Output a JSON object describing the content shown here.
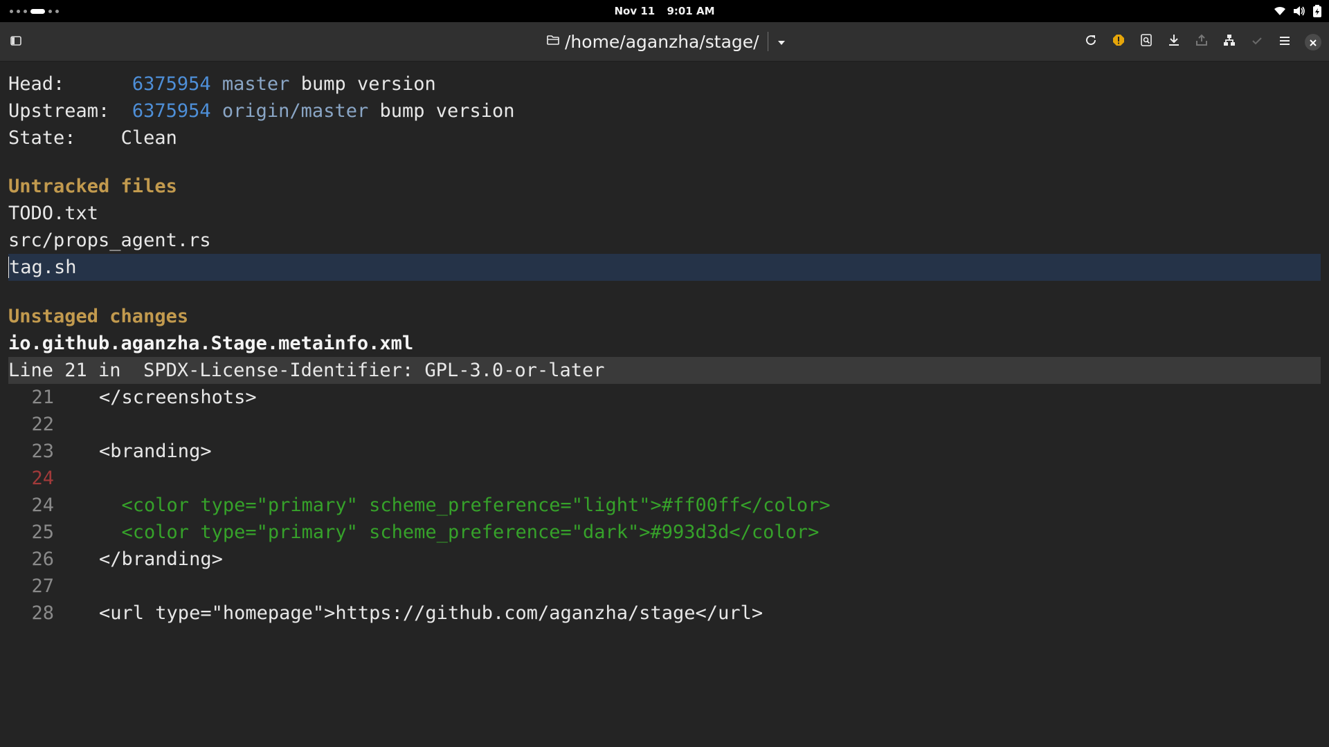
{
  "system_bar": {
    "date": "Nov 11",
    "time": "9:01 AM",
    "workspace_count": 6,
    "active_workspace": 4
  },
  "header": {
    "path": "/home/aganzha/stage/",
    "icons": [
      "sidebar-toggle-icon",
      "folder-icon",
      "dropdown-arrow-icon",
      "refresh-icon",
      "warning-icon",
      "search-icon",
      "pull-icon",
      "push-icon",
      "branches-icon",
      "commit-icon",
      "menu-icon",
      "close-icon"
    ]
  },
  "status": {
    "head_label": "Head:",
    "head_hash": "6375954",
    "head_branch": "master",
    "head_message": "bump version",
    "upstream_label": "Upstream:",
    "upstream_hash": "6375954",
    "upstream_branch": "origin/master",
    "upstream_message": "bump version",
    "state_label": "State:",
    "state_value": "Clean"
  },
  "untracked": {
    "title": "Untracked files",
    "files": [
      "TODO.txt",
      "src/props_agent.rs",
      "tag.sh"
    ]
  },
  "unstaged": {
    "title": "Unstaged changes",
    "file": "io.github.aganzha.Stage.metainfo.xml",
    "hunk_header": "Line 21 in  SPDX-License-Identifier: GPL-3.0-or-later",
    "lines": [
      {
        "num": "21",
        "text": "    </screenshots>",
        "kind": "context"
      },
      {
        "num": "22",
        "text": "",
        "kind": "context"
      },
      {
        "num": "23",
        "text": "    <branding>",
        "kind": "context"
      },
      {
        "num": "24",
        "text": "",
        "kind": "deleted"
      },
      {
        "num": "24",
        "text": "      <color type=\"primary\" scheme_preference=\"light\">#ff00ff</color>",
        "kind": "added"
      },
      {
        "num": "25",
        "text": "      <color type=\"primary\" scheme_preference=\"dark\">#993d3d</color>",
        "kind": "added"
      },
      {
        "num": "26",
        "text": "    </branding>",
        "kind": "context"
      },
      {
        "num": "27",
        "text": "",
        "kind": "context"
      },
      {
        "num": "28",
        "text": "    <url type=\"homepage\">https://github.com/aganzha/stage</url>",
        "kind": "context"
      }
    ]
  },
  "colors": {
    "background": "#242424",
    "hash": "#4e8fd8",
    "branch": "#8aa6c6",
    "section": "#c29a4e",
    "added": "#36a22a",
    "deleted_number": "#a23a3a",
    "selection": "#253348",
    "warning_icon": "#e5a50a"
  }
}
